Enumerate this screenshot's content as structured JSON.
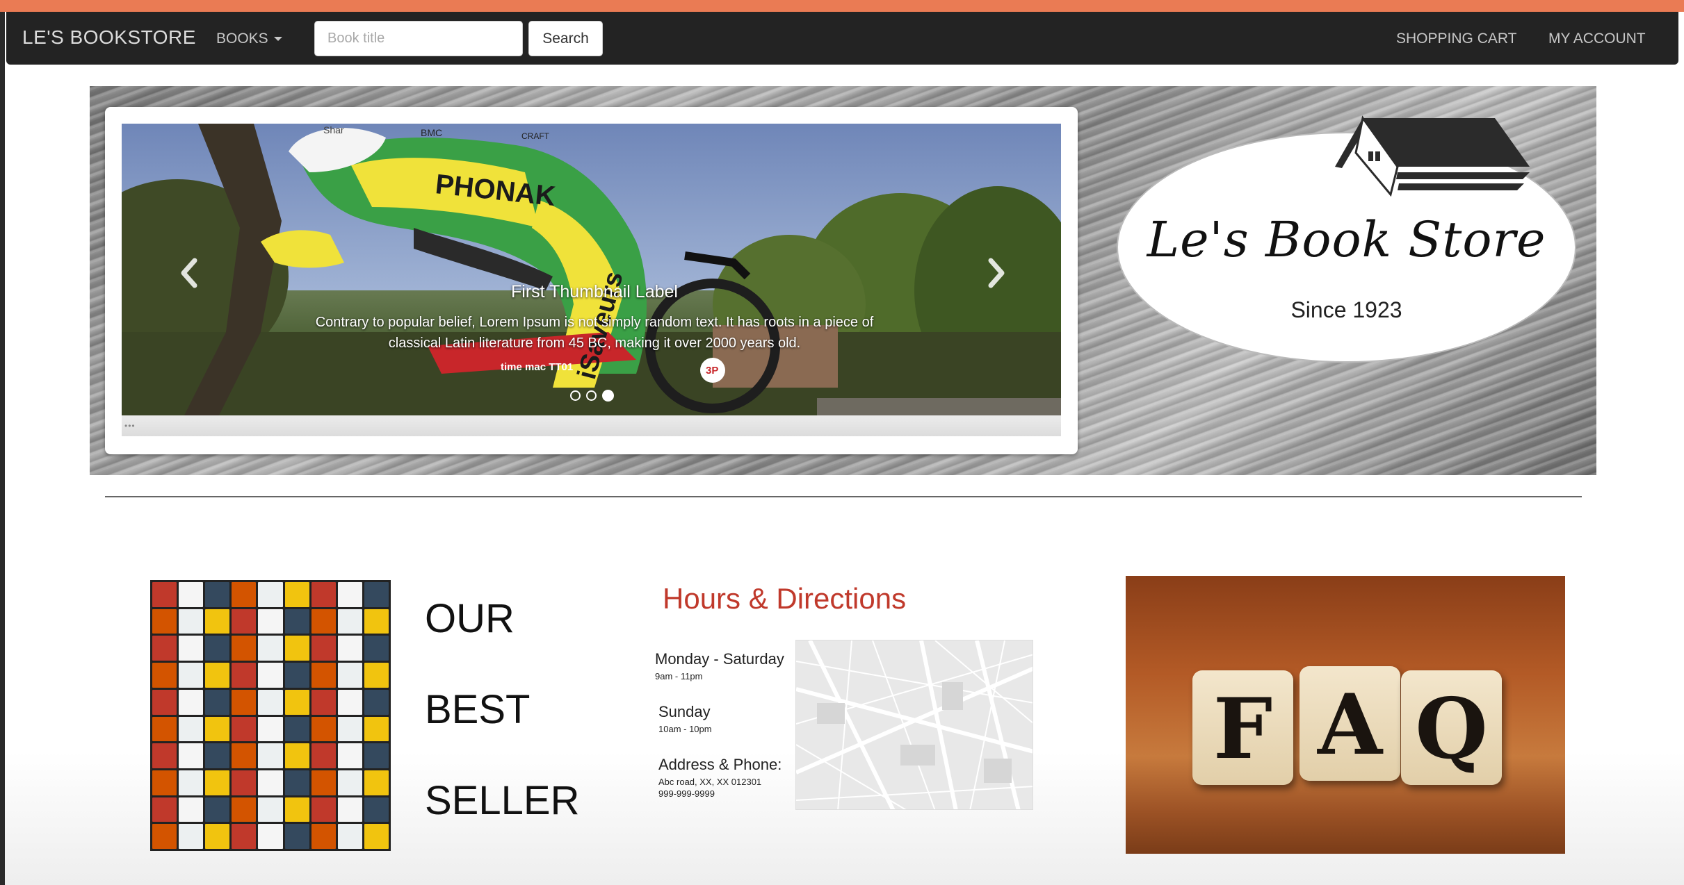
{
  "navbar": {
    "brand": "LE'S BOOKSTORE",
    "books_menu": "BOOKS",
    "search_placeholder": "Book title",
    "search_button": "Search",
    "shopping_cart": "SHOPPING CART",
    "my_account": "MY ACCOUNT"
  },
  "carousel": {
    "caption_title": "First Thumbnail Label",
    "caption_text": "Contrary to popular belief, Lorem Ipsum is not simply random text. It has roots in a piece of classical Latin literature from 45 BC, making it over 2000 years old.",
    "slide_count": 3,
    "active_slide": 3,
    "image_text": "PHONAK",
    "image_text_2": "iSaveurs",
    "image_text_3": "BMC",
    "image_text_4": "Shar",
    "image_text_5": "CRAFT",
    "image_text_6": "time mac TT01",
    "image_text_7": "3P"
  },
  "logo": {
    "name": "Le's Book Store",
    "since": "Since 1923"
  },
  "bestseller": {
    "line1": "OUR",
    "line2": "BEST",
    "line3": "SELLER"
  },
  "hours": {
    "title": "Hours & Directions",
    "weekday_label": "Monday - Saturday",
    "weekday_hours": "9am - 11pm",
    "sunday_label": "Sunday",
    "sunday_hours": "10am - 10pm",
    "address_label": "Address & Phone:",
    "address": "Abc road, XX, XX 012301",
    "phone": "999-999-9999"
  },
  "faq": {
    "letter1": "F",
    "letter2": "A",
    "letter3": "Q"
  },
  "colors": {
    "accent_stripe": "#ea7b54",
    "navbar_bg": "#232323",
    "hours_title": "#c0392b"
  }
}
